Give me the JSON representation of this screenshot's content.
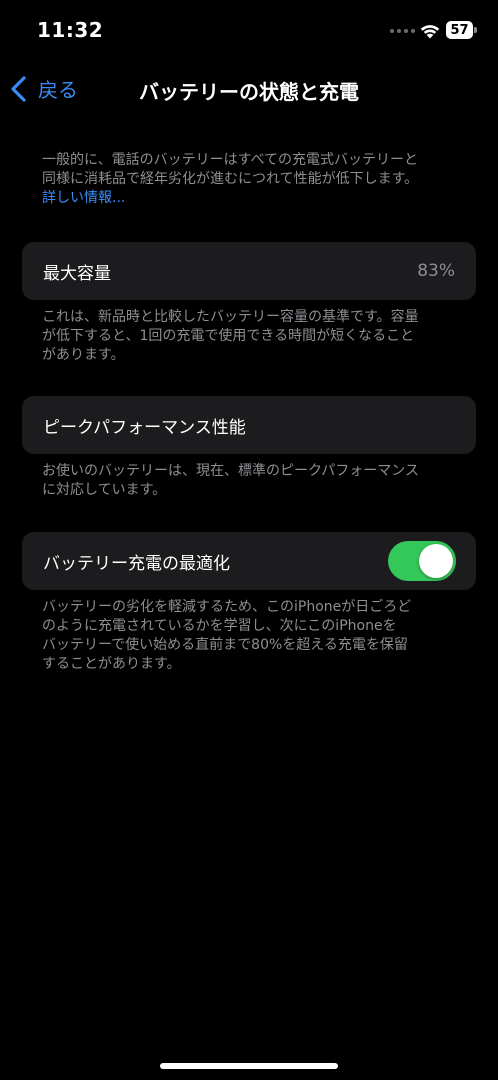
{
  "status_bar": {
    "time": "11:32",
    "battery_level": "57",
    "icons": [
      "wifi-icon",
      "battery-icon"
    ]
  },
  "nav": {
    "back_label": "戻る",
    "title": "バッテリーの状態と充電",
    "back_icon": "chevron-left-icon",
    "accent_color": "#3a8cf5"
  },
  "intro": {
    "line1": "一般的に、電話のバッテリーはすべての充電式バッテリーと",
    "line2": "同様に消耗品で経年劣化が進むにつれて性能が低下します。",
    "link": "詳しい情報..."
  },
  "max_capacity": {
    "label": "最大容量",
    "value": "83%",
    "footer_lines": [
      "これは、新品時と比較したバッテリー容量の基準です。容量",
      "が低下すると、1回の充電で使用できる時間が短くなること",
      "があります。"
    ]
  },
  "peak_performance": {
    "label": "ピークパフォーマンス性能",
    "footer_lines": [
      "お使いのバッテリーは、現在、標準のピークパフォーマンス",
      "に対応しています。"
    ]
  },
  "optimized_charging": {
    "label": "バッテリー充電の最適化",
    "enabled": true,
    "toggle_color": "#34c759",
    "footer_lines": [
      "バッテリーの劣化を軽減するため、このiPhoneが日ごろど",
      "のように充電されているかを学習し、次にこのiPhoneを",
      "バッテリーで使い始める直前まで80%を超える充電を保留",
      "することがあります。"
    ]
  }
}
